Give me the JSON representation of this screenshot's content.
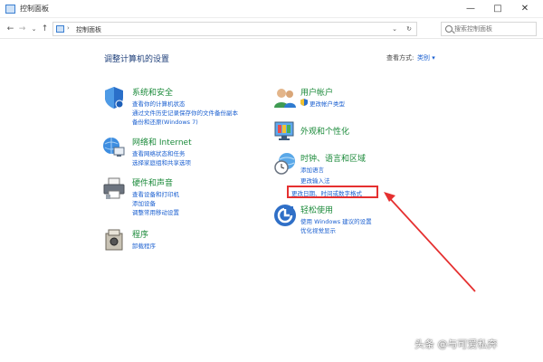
{
  "window": {
    "title": "控制面板",
    "min_glyph": "—",
    "max_glyph": "□",
    "close_glyph": "✕"
  },
  "nav": {
    "back_glyph": "←",
    "forward_glyph": "→",
    "history_glyph": "⌄",
    "up_glyph": "↑",
    "address_sep": "›",
    "address": "控制面板",
    "dropdown_glyph": "⌄",
    "refresh_glyph": "↻",
    "search_placeholder": "搜索控制面板"
  },
  "header": {
    "title": "调整计算机的设置",
    "view_by_label": "查看方式:",
    "view_by_value": "类别 ▾"
  },
  "categories": [
    {
      "title": "系统和安全",
      "icon": "shield-icon",
      "links": [
        "查看你的计算机状态",
        "通过文件历史记录保存你的文件备份副本",
        "备份和还原(Windows 7)"
      ]
    },
    {
      "title": "网络和 Internet",
      "icon": "network-icon",
      "links": [
        "查看网络状态和任务",
        "选择家庭组和共享选项"
      ]
    },
    {
      "title": "硬件和声音",
      "icon": "printer-icon",
      "links": [
        "查看设备和打印机",
        "添加设备",
        "调整常用移动设置"
      ]
    },
    {
      "title": "程序",
      "icon": "programs-icon",
      "links": [
        "卸载程序"
      ]
    },
    {
      "title": "用户帐户",
      "icon": "users-icon",
      "links": [
        "更改帐户类型"
      ]
    },
    {
      "title": "外观和个性化",
      "icon": "appearance-icon",
      "links": []
    },
    {
      "title": "时钟、语言和区域",
      "icon": "clock-globe-icon",
      "links": [
        "添加语言",
        "更改输入法",
        "更改日期、时间或数字格式"
      ]
    },
    {
      "title": "轻松使用",
      "icon": "ease-of-access-icon",
      "links": [
        "使用 Windows 建议的设置",
        "优化视觉显示"
      ]
    }
  ],
  "colors": {
    "category_title": "#1b8a3a",
    "link": "#1a5fd0",
    "annotation": "#e53030"
  },
  "watermark": "头条 @与可爱私奔"
}
